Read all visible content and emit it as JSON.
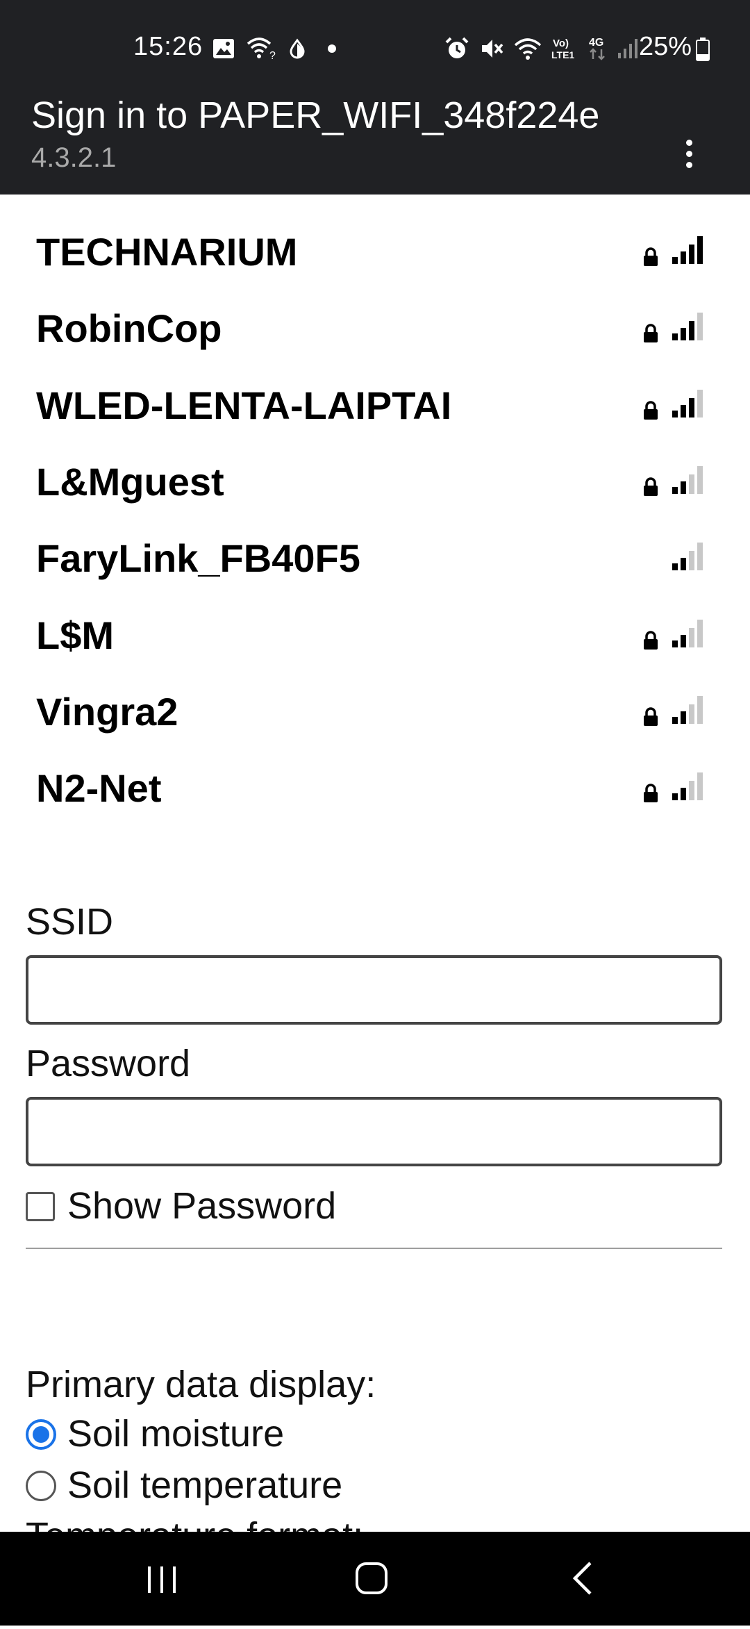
{
  "status_bar": {
    "time": "15:26",
    "battery_percent": "25%",
    "left_icons": [
      "image-icon",
      "wifi-question-icon",
      "data-saver-icon",
      "dot-icon"
    ],
    "right_icons": [
      "alarm-icon",
      "mute-icon",
      "wifi-icon",
      "volte-icon",
      "4g-icon",
      "cell-signal-icon",
      "battery-icon"
    ],
    "volte_label": "Vo) LTE1",
    "network_type": "4G"
  },
  "app_bar": {
    "title": "Sign in to PAPER_WIFI_348f224e",
    "subtitle": "4.3.2.1",
    "menu_icon": "more-vert-icon"
  },
  "networks": [
    {
      "name": "TECHNARIUM",
      "secured": true,
      "signal_bars": 4
    },
    {
      "name": "RobinCop",
      "secured": true,
      "signal_bars": 3
    },
    {
      "name": "WLED-LENTA-LAIPTAI",
      "secured": true,
      "signal_bars": 3
    },
    {
      "name": "L&Mguest",
      "secured": true,
      "signal_bars": 2
    },
    {
      "name": "FaryLink_FB40F5",
      "secured": false,
      "signal_bars": 2
    },
    {
      "name": "L$M",
      "secured": true,
      "signal_bars": 2
    },
    {
      "name": "Vingra2",
      "secured": true,
      "signal_bars": 2
    },
    {
      "name": "N2-Net",
      "secured": true,
      "signal_bars": 2
    }
  ],
  "form": {
    "ssid_label": "SSID",
    "ssid_value": "",
    "password_label": "Password",
    "password_value": "",
    "show_password_label": "Show Password",
    "show_password_checked": false,
    "primary_display_label": "Primary data display:",
    "primary_options": [
      {
        "label": "Soil moisture",
        "checked": true
      },
      {
        "label": "Soil temperature",
        "checked": false
      }
    ],
    "temperature_format_label": "Temperature format:"
  },
  "colors": {
    "bar_background": "#202124",
    "accent": "#1a73e8",
    "signal_active": "#000000",
    "signal_inactive": "#c8c8c8"
  },
  "nav_bar": {
    "buttons": [
      "recents-icon",
      "home-icon",
      "back-icon"
    ]
  }
}
